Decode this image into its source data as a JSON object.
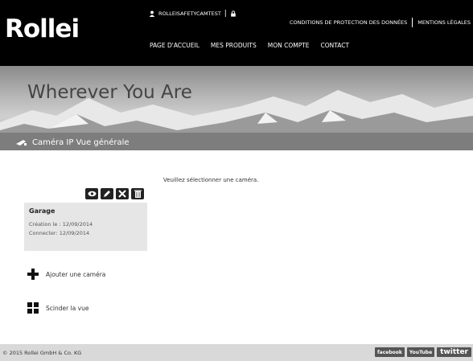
{
  "header": {
    "logo": "Rollei",
    "username": "ROLLEISAFETYCAMTEST",
    "legal_links": [
      "CONDITIONS DE PROTECTION DES DONNÉES",
      "MENTIONS LÉGALES"
    ],
    "nav": [
      "PAGE D'ACCUEIL",
      "MES PRODUITS",
      "MON COMPTE",
      "CONTACT"
    ]
  },
  "banner": {
    "title": "Wherever You Are",
    "breadcrumb": "Caméra IP  Vue générale"
  },
  "content": {
    "message": "Veuillez sélectionner une caméra.",
    "camera": {
      "name": "Garage",
      "created": "Création le : 12/09/2014",
      "connected": "Connecter: 12/09/2014"
    },
    "tools": [
      "eye-icon",
      "pencil-icon",
      "wrench-icon",
      "trash-icon"
    ],
    "add_camera": "Ajouter une caméra",
    "split_view": "Scinder la vue"
  },
  "footer": {
    "copyright": "© 2015 Rollei GmbH & Co. KG",
    "social": [
      "facebook",
      "YouTube",
      "twitter"
    ]
  }
}
